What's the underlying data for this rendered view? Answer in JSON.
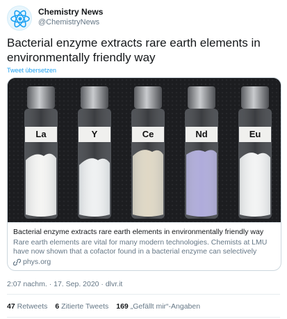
{
  "author": {
    "name": "Chemistry News",
    "handle": "@ChemistryNews"
  },
  "tweet": {
    "text": "Bacterial enzyme extracts rare earth elements in environmentally friendly way",
    "translate_link": "Tweet übersetzen",
    "timestamp": "2:07 nachm. · 17. Sep. 2020 · dlvr.it"
  },
  "card": {
    "vials": [
      "La",
      "Y",
      "Ce",
      "Nd",
      "Eu"
    ],
    "title": "Bacterial enzyme extracts rare earth elements in environmentally friendly way",
    "description": "Rare earth elements are vital for many modern technologies. Chemists at LMU have now shown that a cofactor found in a bacterial enzyme can selectively extra...",
    "source": "phys.org",
    "source_icon": "link-icon"
  },
  "stats": {
    "retweets_count": "47",
    "retweets_label": "Retweets",
    "quotes_count": "6",
    "quotes_label": "Zitierte Tweets",
    "likes_count": "169",
    "likes_label": "„Gefällt mir“-Angaben"
  },
  "colors": {
    "accent": "#1da1f2",
    "secondary_text": "#657786",
    "border": "#ccd6dd"
  }
}
